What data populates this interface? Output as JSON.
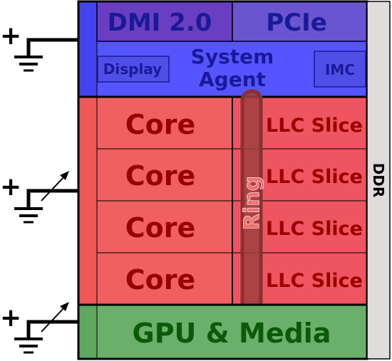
{
  "system_agent": {
    "dmi_label": "DMI 2.0",
    "pcie_label": "PCIe",
    "display_label": "Display",
    "agent_line1": "System",
    "agent_line2": "Agent",
    "imc_label": "IMC"
  },
  "cores": [
    {
      "core_label": "Core",
      "llc_label": "LLC Slice"
    },
    {
      "core_label": "Core",
      "llc_label": "LLC Slice"
    },
    {
      "core_label": "Core",
      "llc_label": "LLC Slice"
    },
    {
      "core_label": "Core",
      "llc_label": "LLC Slice"
    }
  ],
  "ring_label": "Ring",
  "gpu_label": "GPU & Media",
  "ddr_label": "DDR",
  "power_sources": [
    {
      "sign": "+",
      "type": "fixed"
    },
    {
      "sign": "+",
      "type": "variable"
    },
    {
      "sign": "+",
      "type": "variable"
    }
  ],
  "colors": {
    "agent_blue": "#5555ff",
    "dmi_purple": "#6a3ec0",
    "pcie_purple": "#6a55d0",
    "agent_text": "#1a1a99",
    "core_red": "#f06060",
    "core_text": "#9a0000",
    "llc_red": "#ee5560",
    "ring_fill": "#a04040",
    "ring_top": "#3f3faa",
    "ring_bottom": "#2a8a40",
    "gpu_green": "#6ab06a",
    "gpu_text": "#0a5a0a",
    "ddr_gray": "#e0dcdc"
  }
}
